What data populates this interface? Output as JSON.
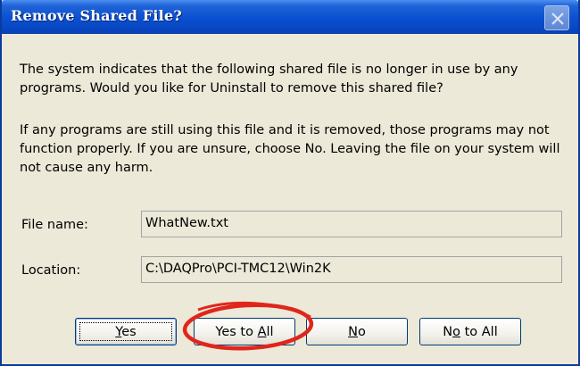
{
  "window": {
    "title": "Remove Shared File?",
    "close_icon": "close-icon"
  },
  "message": {
    "paragraph1": "The system indicates that the following shared file is no longer in use by any programs. Would you like for Uninstall to remove this shared file?",
    "paragraph2": "If any programs are still using this file and it is removed, those programs may not function properly. If you are unsure, choose No. Leaving the file on your system will not cause any harm."
  },
  "fields": {
    "file_name_label": "File name:",
    "file_name_value": "WhatNew.txt",
    "location_label": "Location:",
    "location_value": "C:\\DAQPro\\PCI-TMC12\\Win2K"
  },
  "buttons": {
    "yes": {
      "pre": "",
      "key": "Y",
      "post": "es"
    },
    "yes_to_all": {
      "pre": "Yes to ",
      "key": "A",
      "post": "ll"
    },
    "no": {
      "pre": "",
      "key": "N",
      "post": "o"
    },
    "no_to_all": {
      "pre": "N",
      "key": "o",
      "post": " to All"
    }
  },
  "colors": {
    "titlebar": "#0a4fd0",
    "dialog_bg": "#ece9d8",
    "annotation": "#e0261c"
  }
}
